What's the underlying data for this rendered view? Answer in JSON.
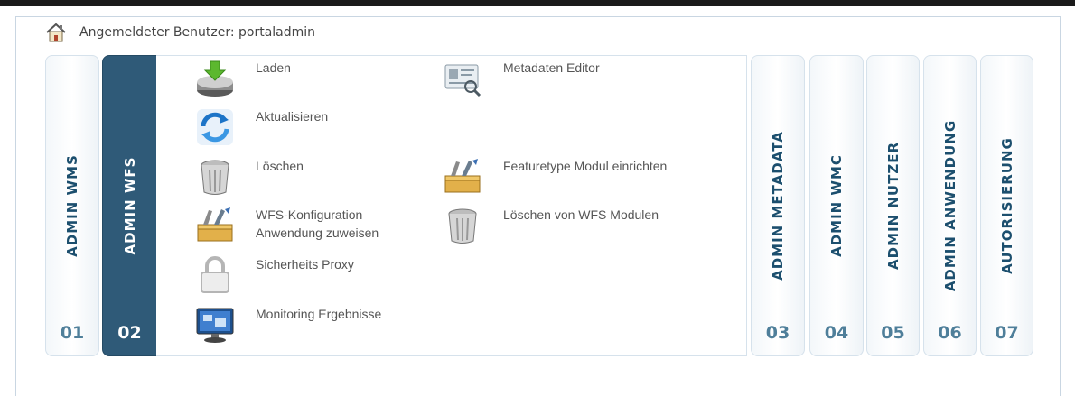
{
  "header": {
    "user_label": "Angemeldeter Benutzer:",
    "user_name": "portaladmin"
  },
  "tabs": [
    {
      "title": "ADMIN WMS",
      "number": "01",
      "active": false
    },
    {
      "title": "ADMIN WFS",
      "number": "02",
      "active": true
    },
    {
      "title": "ADMIN METADATA",
      "number": "03",
      "active": false
    },
    {
      "title": "ADMIN WMC",
      "number": "04",
      "active": false
    },
    {
      "title": "ADMIN NUTZER",
      "number": "05",
      "active": false
    },
    {
      "title": "ADMIN ANWENDUNG",
      "number": "06",
      "active": false
    },
    {
      "title": "AUTORISIERUNG",
      "number": "07",
      "active": false
    }
  ],
  "panel": {
    "items": [
      {
        "label": "Laden",
        "icon": "download-drive-icon"
      },
      {
        "label": "Metadaten Editor",
        "icon": "id-card-icon"
      },
      {
        "label": "Aktualisieren",
        "icon": "refresh-icon"
      },
      {
        "label": "Löschen",
        "icon": "trash-icon"
      },
      {
        "label": "Featuretype Modul einrichten",
        "icon": "toolbox-icon"
      },
      {
        "label": "WFS-Konfiguration Anwendung zuweisen",
        "icon": "toolbox-icon"
      },
      {
        "label": "Löschen von WFS Modulen",
        "icon": "trash-icon"
      },
      {
        "label": "Sicherheits Proxy",
        "icon": "padlock-icon"
      },
      {
        "label": "Monitoring Ergebnisse",
        "icon": "monitor-icon"
      }
    ]
  },
  "colors": {
    "active_tab": "#2f5a78",
    "tab_title": "#1c4f6e",
    "tab_number": "#4f7f9a",
    "tab_border": "#d6e2ec"
  }
}
